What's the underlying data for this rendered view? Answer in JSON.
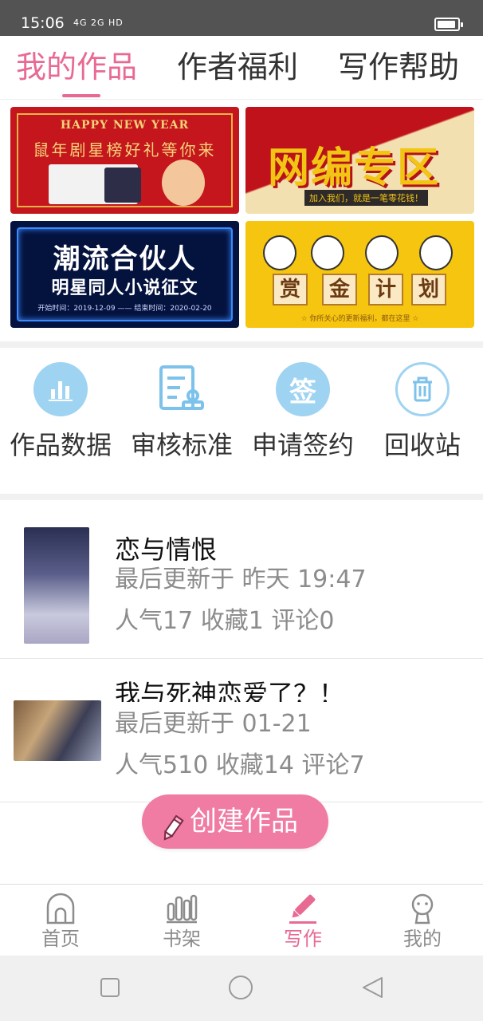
{
  "status_bar": {
    "time": "15:06",
    "signal_text": "4G 2G HD",
    "battery_icon": "battery-icon"
  },
  "tabs": [
    {
      "label": "我的作品",
      "active": true
    },
    {
      "label": "作者福利",
      "active": false
    },
    {
      "label": "写作帮助",
      "active": false
    }
  ],
  "banners": {
    "new_year": {
      "line1": "HAPPY NEW YEAR",
      "line2": "鼠年剧星榜好礼等你来"
    },
    "editor": {
      "title": "网编专区",
      "subtitle": "加入我们，就是一笔零花钱！"
    },
    "partner": {
      "title": "潮流合伙人",
      "subtitle": "明星同人小说征文",
      "dates": "开始时间：2019-12-09 —— 结束时间：2020-02-20"
    },
    "bounty": {
      "words": [
        "赏",
        "金",
        "计",
        "划"
      ],
      "footer": "☆ 你所关心的更新福利，都在这里 ☆"
    }
  },
  "tools": [
    {
      "label": "作品数据",
      "icon": "bar-chart-icon"
    },
    {
      "label": "审核标准",
      "icon": "document-stamp-icon"
    },
    {
      "label": "申请签约",
      "icon": "sign-icon",
      "icon_text": "签"
    },
    {
      "label": "回收站",
      "icon": "trash-icon"
    }
  ],
  "works": [
    {
      "title": "恋与情恨",
      "updated": "最后更新于 昨天 19:47",
      "stats": "人气17 收藏1 评论0"
    },
    {
      "title": "我与死神恋爱了？！",
      "updated": "最后更新于 01-21",
      "stats": "人气510 收藏14 评论7"
    }
  ],
  "create_button": {
    "label": "创建作品",
    "icon": "pencil-icon"
  },
  "bottom_nav": [
    {
      "label": "首页",
      "icon": "home-icon",
      "active": false
    },
    {
      "label": "书架",
      "icon": "bookshelf-icon",
      "active": false
    },
    {
      "label": "写作",
      "icon": "pen-icon",
      "active": true
    },
    {
      "label": "我的",
      "icon": "profile-icon",
      "active": false
    }
  ],
  "colors": {
    "accent": "#e86a92",
    "button": "#f07ba3",
    "tool_icon_bg": "#9fd3f2",
    "tool_icon_stroke": "#7cc2eb"
  }
}
